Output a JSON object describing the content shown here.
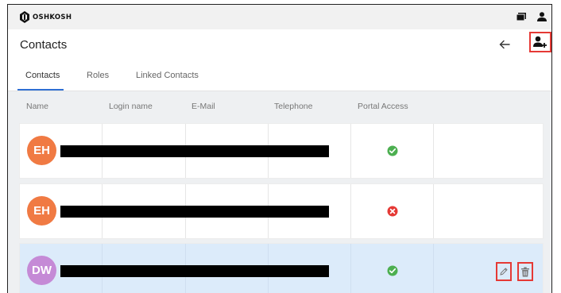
{
  "brand": {
    "logo_text": "OSHKOSH"
  },
  "header": {
    "title": "Contacts"
  },
  "tabs": [
    {
      "label": "Contacts",
      "active": true
    },
    {
      "label": "Roles",
      "active": false
    },
    {
      "label": "Linked Contacts",
      "active": false
    }
  ],
  "table": {
    "columns": [
      "Name",
      "Login name",
      "E-Mail",
      "Telephone",
      "Portal Access"
    ],
    "rows": [
      {
        "initials": "EH",
        "avatar_color": "#f07a43",
        "portal_access": true,
        "selected": false
      },
      {
        "initials": "EH",
        "avatar_color": "#f07a43",
        "portal_access": false,
        "selected": false
      },
      {
        "initials": "DW",
        "avatar_color": "#c58ad6",
        "portal_access": true,
        "selected": true
      }
    ]
  },
  "colors": {
    "accent": "#2f6fd3",
    "success": "#4caf50",
    "error": "#e53935",
    "highlight": "#e53935"
  }
}
